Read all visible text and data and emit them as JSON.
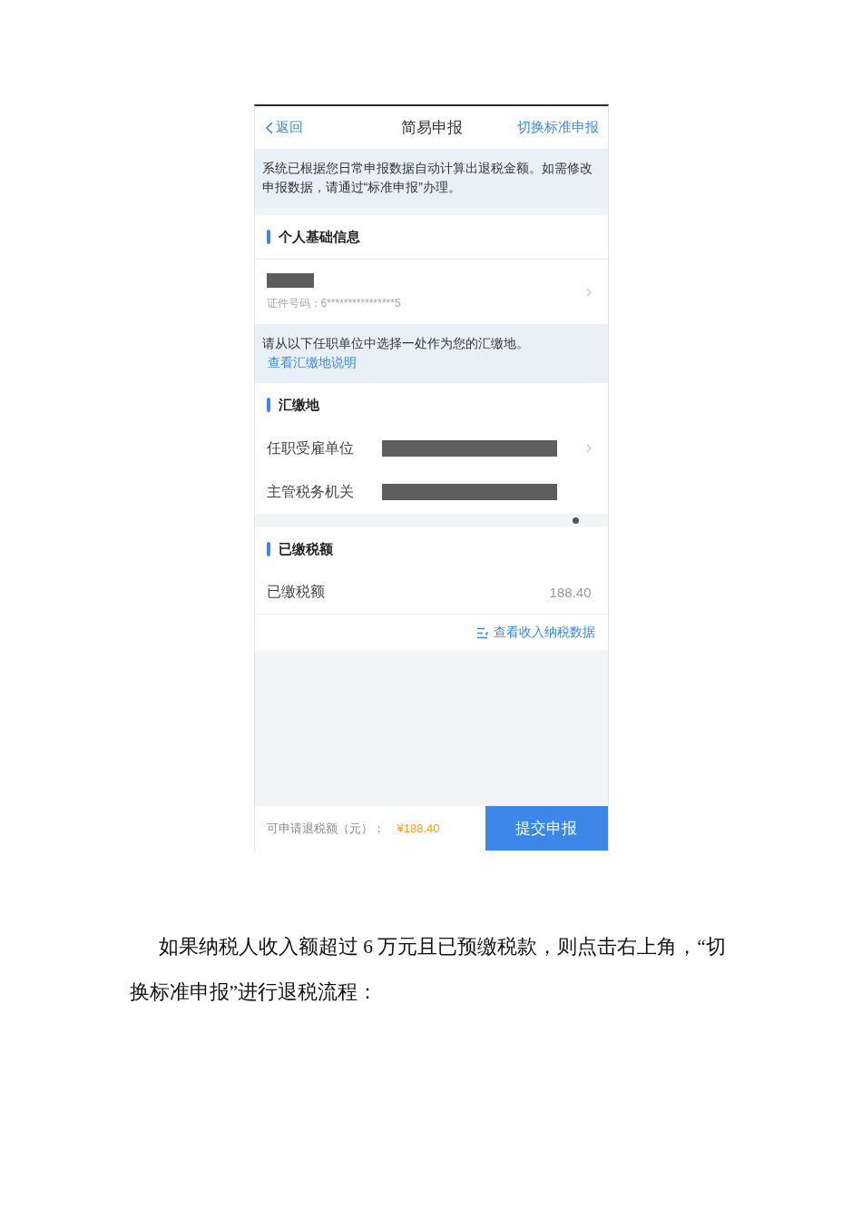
{
  "nav_bar": {
    "back": "返回",
    "title": "简易申报",
    "action": "切换标准申报"
  },
  "blocks": [
    {
      "kind": "notice",
      "text": "系统已根据您日常申报数据自动计算出退税金额。如需修改申报数据，请通过“标准申报”办理。"
    },
    {
      "kind": "section",
      "title": "个人基础信息",
      "rows": [
        {
          "kind": "identity",
          "redacted": true,
          "text": "证件号码：6****************5",
          "chevron": true
        }
      ]
    },
    {
      "kind": "notice",
      "text": "请从以下任职单位中选择一处作为您的汇缴地。",
      "link": "查看汇缴地说明"
    },
    {
      "kind": "section",
      "title": "汇缴地",
      "rows": [
        {
          "kind": "field",
          "label": "任职受雇单位",
          "redacted": true,
          "chevron": true
        },
        {
          "kind": "field",
          "label": "主管税务机关",
          "redacted": true,
          "chevron": false
        }
      ]
    },
    {
      "kind": "section",
      "title": "已缴税额",
      "rows": [
        {
          "kind": "field",
          "label": "已缴税额",
          "redacted": false,
          "value": "188.40",
          "chevron": false
        }
      ],
      "link": "查看收入纳税数据"
    }
  ],
  "footer": {
    "label": "可申请退税额（元）：",
    "amount": "¥188.40",
    "submit": "提交申报"
  },
  "caption": "如果纳税人收入额超过 6 万元且已预缴税款，则点击右上角，“切换标准申报”进行退税流程："
}
